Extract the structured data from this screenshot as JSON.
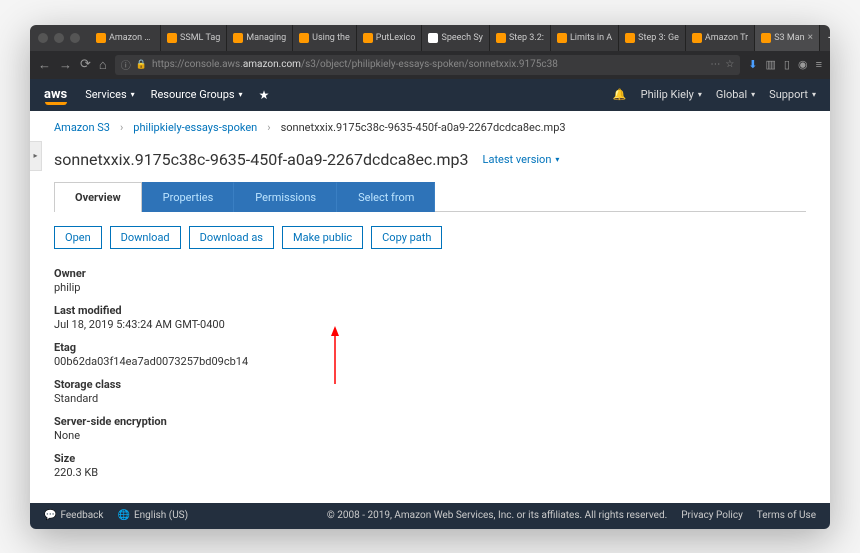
{
  "browser": {
    "tabs": [
      {
        "label": "Amazon Po"
      },
      {
        "label": "SSML Tag"
      },
      {
        "label": "Managing"
      },
      {
        "label": "Using the"
      },
      {
        "label": "PutLexico"
      },
      {
        "label": "Speech Sy",
        "icon": "white"
      },
      {
        "label": "Step 3.2:"
      },
      {
        "label": "Limits in A"
      },
      {
        "label": "Step 3: Ge"
      },
      {
        "label": "Amazon Tr"
      },
      {
        "label": "S3 Man",
        "active": true
      }
    ],
    "url_prefix": "https://console.aws.",
    "url_host": "amazon.com",
    "url_path": "/s3/object/philipkiely-essays-spoken/sonnetxxix.9175c38"
  },
  "aws": {
    "logo": "aws",
    "nav": {
      "services": "Services",
      "resource_groups": "Resource Groups"
    },
    "right": {
      "user": "Philip Kiely",
      "region": "Global",
      "support": "Support"
    }
  },
  "breadcrumb": {
    "root": "Amazon S3",
    "bucket": "philipkiely-essays-spoken",
    "object": "sonnetxxix.9175c38c-9635-450f-a0a9-2267dcdca8ec.mp3"
  },
  "page": {
    "title": "sonnetxxix.9175c38c-9635-450f-a0a9-2267dcdca8ec.mp3",
    "version": "Latest version"
  },
  "tabs": {
    "overview": "Overview",
    "properties": "Properties",
    "permissions": "Permissions",
    "select_from": "Select from"
  },
  "actions": {
    "open": "Open",
    "download": "Download",
    "download_as": "Download as",
    "make_public": "Make public",
    "copy_path": "Copy path"
  },
  "details": {
    "owner_label": "Owner",
    "owner_value": "philip",
    "last_modified_label": "Last modified",
    "last_modified_value": "Jul 18, 2019 5:43:24 AM GMT-0400",
    "etag_label": "Etag",
    "etag_value": "00b62da03f14ea7ad0073257bd09cb14",
    "storage_class_label": "Storage class",
    "storage_class_value": "Standard",
    "encryption_label": "Server-side encryption",
    "encryption_value": "None",
    "size_label": "Size",
    "size_value": "220.3 KB"
  },
  "footer": {
    "feedback": "Feedback",
    "language": "English (US)",
    "copyright": "© 2008 - 2019, Amazon Web Services, Inc. or its affiliates. All rights reserved.",
    "privacy": "Privacy Policy",
    "terms": "Terms of Use"
  }
}
